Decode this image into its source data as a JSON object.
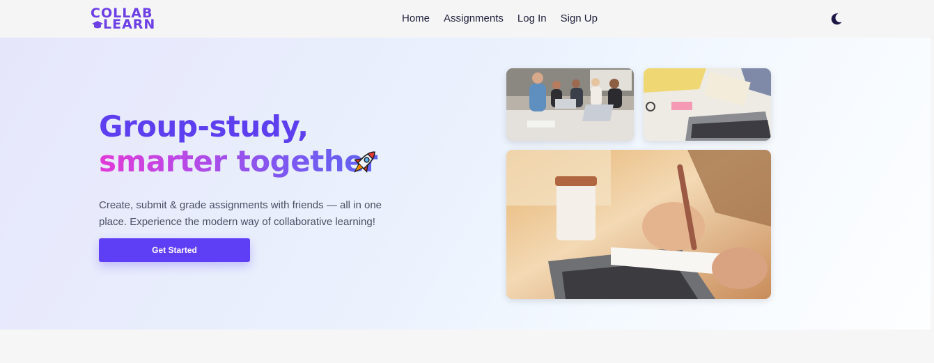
{
  "logo": {
    "line1": "COLLAB",
    "line2": "LEARN"
  },
  "nav": {
    "links": [
      "Home",
      "Assignments",
      "Log In",
      "Sign Up"
    ]
  },
  "theme_toggle": {
    "icon": "moon-icon"
  },
  "hero": {
    "title_line1": "Group-study,",
    "title_line2": "smarter together",
    "title_emoji": "rocket-icon",
    "description": "Create, submit & grade assignments with friends — all in one place. Experience the modern way of collaborative learning!",
    "cta_label": "Get Started"
  },
  "colors": {
    "brand": "#6c3fe6",
    "button": "#5f3ff6",
    "title": "#5d3ff0",
    "gradient_start": "#e23ad8",
    "gradient_end": "#5f63f4"
  }
}
